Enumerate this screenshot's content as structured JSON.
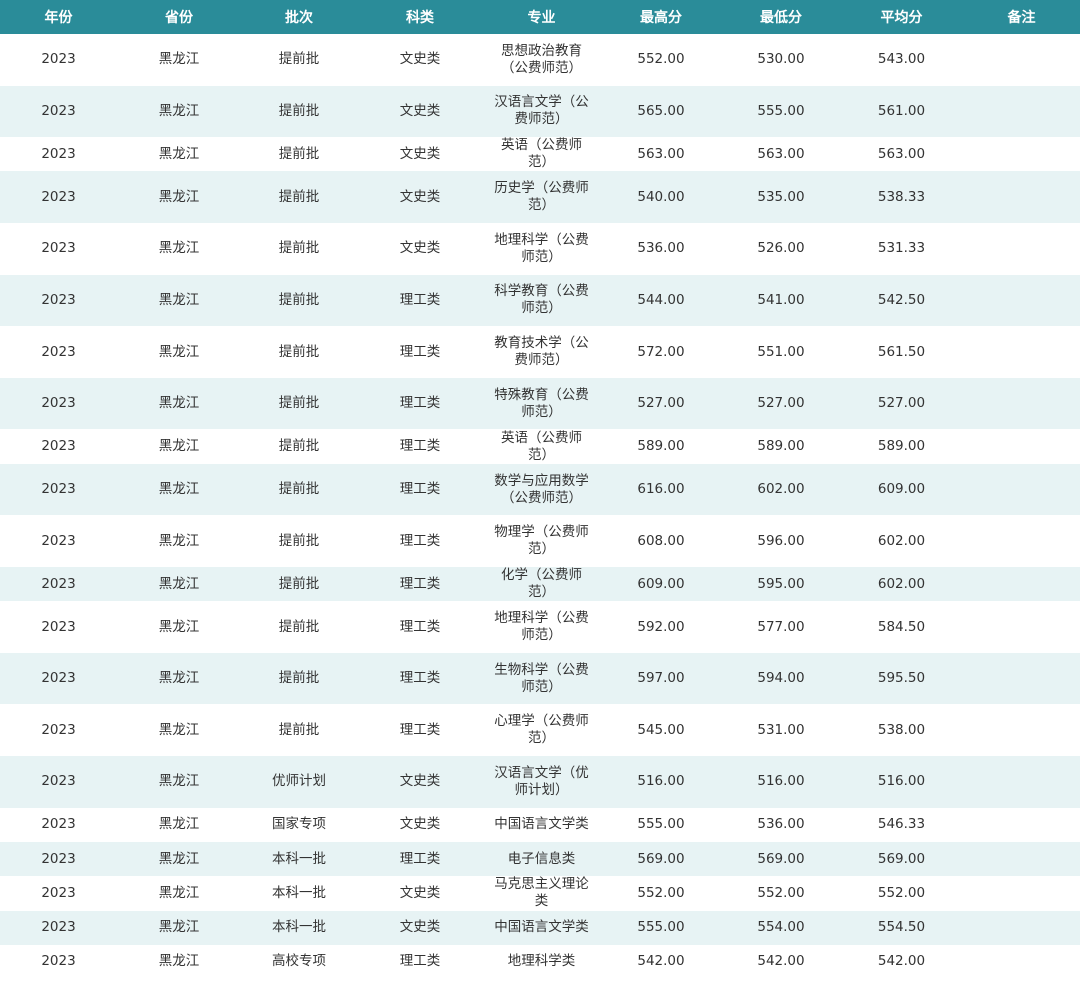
{
  "header": [
    "年份",
    "省份",
    "批次",
    "科类",
    "专业",
    "最高分",
    "最低分",
    "平均分",
    "备注"
  ],
  "rows": [
    {
      "year": "2023",
      "province": "黑龙江",
      "batch": "提前批",
      "category": "文史类",
      "major": "思想政治教育（公费师范）",
      "max": "552.00",
      "min": "530.00",
      "avg": "543.00",
      "note": "",
      "tall": true
    },
    {
      "year": "2023",
      "province": "黑龙江",
      "batch": "提前批",
      "category": "文史类",
      "major": "汉语言文学（公费师范）",
      "max": "565.00",
      "min": "555.00",
      "avg": "561.00",
      "note": "",
      "tall": true
    },
    {
      "year": "2023",
      "province": "黑龙江",
      "batch": "提前批",
      "category": "文史类",
      "major": "英语（公费师范）",
      "max": "563.00",
      "min": "563.00",
      "avg": "563.00",
      "note": "",
      "tall": false
    },
    {
      "year": "2023",
      "province": "黑龙江",
      "batch": "提前批",
      "category": "文史类",
      "major": "历史学（公费师范）",
      "max": "540.00",
      "min": "535.00",
      "avg": "538.33",
      "note": "",
      "tall": true
    },
    {
      "year": "2023",
      "province": "黑龙江",
      "batch": "提前批",
      "category": "文史类",
      "major": "地理科学（公费师范）",
      "max": "536.00",
      "min": "526.00",
      "avg": "531.33",
      "note": "",
      "tall": true
    },
    {
      "year": "2023",
      "province": "黑龙江",
      "batch": "提前批",
      "category": "理工类",
      "major": "科学教育（公费师范）",
      "max": "544.00",
      "min": "541.00",
      "avg": "542.50",
      "note": "",
      "tall": true
    },
    {
      "year": "2023",
      "province": "黑龙江",
      "batch": "提前批",
      "category": "理工类",
      "major": "教育技术学（公费师范）",
      "max": "572.00",
      "min": "551.00",
      "avg": "561.50",
      "note": "",
      "tall": true
    },
    {
      "year": "2023",
      "province": "黑龙江",
      "batch": "提前批",
      "category": "理工类",
      "major": "特殊教育（公费师范）",
      "max": "527.00",
      "min": "527.00",
      "avg": "527.00",
      "note": "",
      "tall": true
    },
    {
      "year": "2023",
      "province": "黑龙江",
      "batch": "提前批",
      "category": "理工类",
      "major": "英语（公费师范）",
      "max": "589.00",
      "min": "589.00",
      "avg": "589.00",
      "note": "",
      "tall": false
    },
    {
      "year": "2023",
      "province": "黑龙江",
      "batch": "提前批",
      "category": "理工类",
      "major": "数学与应用数学（公费师范）",
      "max": "616.00",
      "min": "602.00",
      "avg": "609.00",
      "note": "",
      "tall": true
    },
    {
      "year": "2023",
      "province": "黑龙江",
      "batch": "提前批",
      "category": "理工类",
      "major": "物理学（公费师范）",
      "max": "608.00",
      "min": "596.00",
      "avg": "602.00",
      "note": "",
      "tall": true
    },
    {
      "year": "2023",
      "province": "黑龙江",
      "batch": "提前批",
      "category": "理工类",
      "major": "化学（公费师范）",
      "max": "609.00",
      "min": "595.00",
      "avg": "602.00",
      "note": "",
      "tall": false
    },
    {
      "year": "2023",
      "province": "黑龙江",
      "batch": "提前批",
      "category": "理工类",
      "major": "地理科学（公费师范）",
      "max": "592.00",
      "min": "577.00",
      "avg": "584.50",
      "note": "",
      "tall": true
    },
    {
      "year": "2023",
      "province": "黑龙江",
      "batch": "提前批",
      "category": "理工类",
      "major": "生物科学（公费师范）",
      "max": "597.00",
      "min": "594.00",
      "avg": "595.50",
      "note": "",
      "tall": true
    },
    {
      "year": "2023",
      "province": "黑龙江",
      "batch": "提前批",
      "category": "理工类",
      "major": "心理学（公费师范）",
      "max": "545.00",
      "min": "531.00",
      "avg": "538.00",
      "note": "",
      "tall": true
    },
    {
      "year": "2023",
      "province": "黑龙江",
      "batch": "优师计划",
      "category": "文史类",
      "major": "汉语言文学（优师计划）",
      "max": "516.00",
      "min": "516.00",
      "avg": "516.00",
      "note": "",
      "tall": true
    },
    {
      "year": "2023",
      "province": "黑龙江",
      "batch": "国家专项",
      "category": "文史类",
      "major": "中国语言文学类",
      "max": "555.00",
      "min": "536.00",
      "avg": "546.33",
      "note": "",
      "tall": false
    },
    {
      "year": "2023",
      "province": "黑龙江",
      "batch": "本科一批",
      "category": "理工类",
      "major": "电子信息类",
      "max": "569.00",
      "min": "569.00",
      "avg": "569.00",
      "note": "",
      "tall": false
    },
    {
      "year": "2023",
      "province": "黑龙江",
      "batch": "本科一批",
      "category": "文史类",
      "major": "马克思主义理论类",
      "max": "552.00",
      "min": "552.00",
      "avg": "552.00",
      "note": "",
      "tall": false
    },
    {
      "year": "2023",
      "province": "黑龙江",
      "batch": "本科一批",
      "category": "文史类",
      "major": "中国语言文学类",
      "max": "555.00",
      "min": "554.00",
      "avg": "554.50",
      "note": "",
      "tall": false
    },
    {
      "year": "2023",
      "province": "黑龙江",
      "batch": "高校专项",
      "category": "理工类",
      "major": "地理科学类",
      "max": "542.00",
      "min": "542.00",
      "avg": "542.00",
      "note": "",
      "tall": false
    }
  ]
}
